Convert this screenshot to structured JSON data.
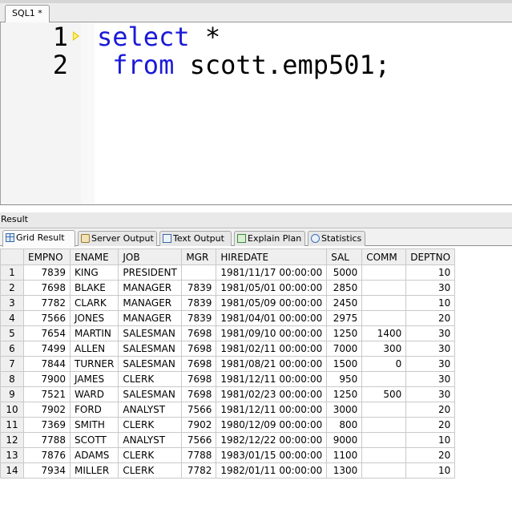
{
  "editor_tab": {
    "label": "SQL1 *"
  },
  "editor": {
    "line_numbers": [
      "1",
      "2"
    ],
    "lines": [
      {
        "keyword": "select",
        "rest": " *"
      },
      {
        "indent": " ",
        "keyword": "from",
        "rest": " scott.emp501;"
      }
    ],
    "keyword_color": "#1a1ad8"
  },
  "result": {
    "title": "Result",
    "tabs": [
      {
        "label": "Grid Result",
        "icon": "grid-icon"
      },
      {
        "label": "Server Output",
        "icon": "server-output-icon"
      },
      {
        "label": "Text Output",
        "icon": "text-output-icon"
      },
      {
        "label": "Explain Plan",
        "icon": "explain-plan-icon"
      },
      {
        "label": "Statistics",
        "icon": "statistics-icon"
      }
    ],
    "columns": [
      "EMPNO",
      "ENAME",
      "JOB",
      "MGR",
      "HIREDATE",
      "SAL",
      "COMM",
      "DEPTNO"
    ],
    "rows": [
      [
        "1",
        "7839",
        "KING",
        "PRESIDENT",
        "",
        "1981/11/17 00:00:00",
        "5000",
        "",
        "10"
      ],
      [
        "2",
        "7698",
        "BLAKE",
        "MANAGER",
        "7839",
        "1981/05/01 00:00:00",
        "2850",
        "",
        "30"
      ],
      [
        "3",
        "7782",
        "CLARK",
        "MANAGER",
        "7839",
        "1981/05/09 00:00:00",
        "2450",
        "",
        "10"
      ],
      [
        "4",
        "7566",
        "JONES",
        "MANAGER",
        "7839",
        "1981/04/01 00:00:00",
        "2975",
        "",
        "20"
      ],
      [
        "5",
        "7654",
        "MARTIN",
        "SALESMAN",
        "7698",
        "1981/09/10 00:00:00",
        "1250",
        "1400",
        "30"
      ],
      [
        "6",
        "7499",
        "ALLEN",
        "SALESMAN",
        "7698",
        "1981/02/11 00:00:00",
        "7000",
        "300",
        "30"
      ],
      [
        "7",
        "7844",
        "TURNER",
        "SALESMAN",
        "7698",
        "1981/08/21 00:00:00",
        "1500",
        "0",
        "30"
      ],
      [
        "8",
        "7900",
        "JAMES",
        "CLERK",
        "7698",
        "1981/12/11 00:00:00",
        "950",
        "",
        "30"
      ],
      [
        "9",
        "7521",
        "WARD",
        "SALESMAN",
        "7698",
        "1981/02/23 00:00:00",
        "1250",
        "500",
        "30"
      ],
      [
        "10",
        "7902",
        "FORD",
        "ANALYST",
        "7566",
        "1981/12/11 00:00:00",
        "3000",
        "",
        "20"
      ],
      [
        "11",
        "7369",
        "SMITH",
        "CLERK",
        "7902",
        "1980/12/09 00:00:00",
        "800",
        "",
        "20"
      ],
      [
        "12",
        "7788",
        "SCOTT",
        "ANALYST",
        "7566",
        "1982/12/22 00:00:00",
        "9000",
        "",
        "10"
      ],
      [
        "13",
        "7876",
        "ADAMS",
        "CLERK",
        "7788",
        "1983/01/15 00:00:00",
        "1100",
        "",
        "20"
      ],
      [
        "14",
        "7934",
        "MILLER",
        "CLERK",
        "7782",
        "1982/01/11 00:00:00",
        "1300",
        "",
        "10"
      ]
    ]
  }
}
